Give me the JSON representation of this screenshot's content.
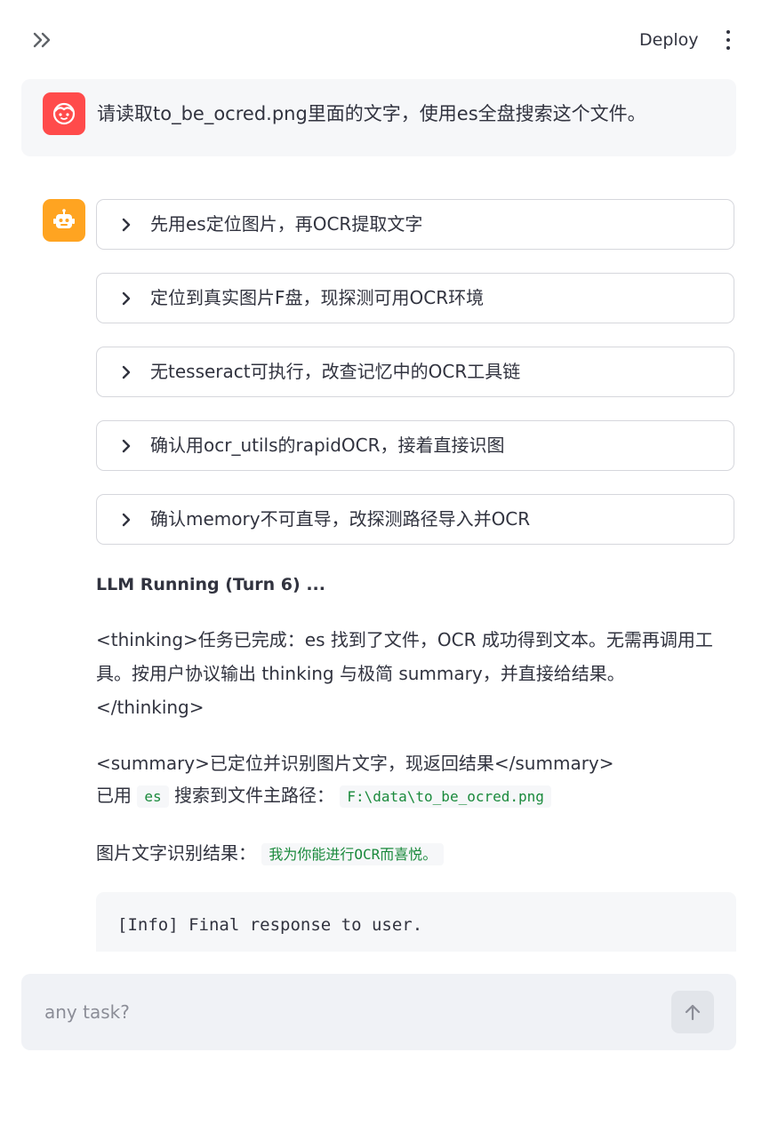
{
  "header": {
    "deploy_label": "Deploy"
  },
  "user_message": {
    "text": "请读取to_be_ocred.png里面的文字，使用es全盘搜索这个文件。"
  },
  "assistant": {
    "steps": [
      "先用es定位图片，再OCR提取文字",
      "定位到真实图片F盘，现探测可用OCR环境",
      "无tesseract可执行，改查记忆中的OCR工具链",
      "确认用ocr_utils的rapidOCR，接着直接识图",
      "确认memory不可直导，改探测路径导入并OCR"
    ],
    "running_title": "LLM Running (Turn 6) ...",
    "thinking": "<thinking>任务已完成：es 找到了文件，OCR 成功得到文本。无需再调用工具。按用户协议输出 thinking 与极简 summary，并直接给结果。</thinking>",
    "summary": "<summary>已定位并识别图片文字，现返回结果</summary>",
    "path_prefix": "已用",
    "path_tool": "es",
    "path_middle": "搜索到文件主路径：",
    "path_value": "F:\\data\\to_be_ocred.png",
    "result_label": "图片文字识别结果：",
    "result_value": "我为你能进行OCR而喜悦。",
    "code_block": "[Info] Final response to user."
  },
  "chat_input": {
    "placeholder": "any task?",
    "value": ""
  },
  "colors": {
    "user_avatar": "#ff4b4b",
    "bot_avatar": "#ffa421",
    "inline_code": "#1a8a3c"
  },
  "icons": {
    "sidebar": "double-chevron-right-icon",
    "menu": "kebab-menu-icon",
    "user": "face-icon",
    "bot": "robot-icon",
    "expander": "chevron-right-icon",
    "send": "arrow-up-icon"
  }
}
